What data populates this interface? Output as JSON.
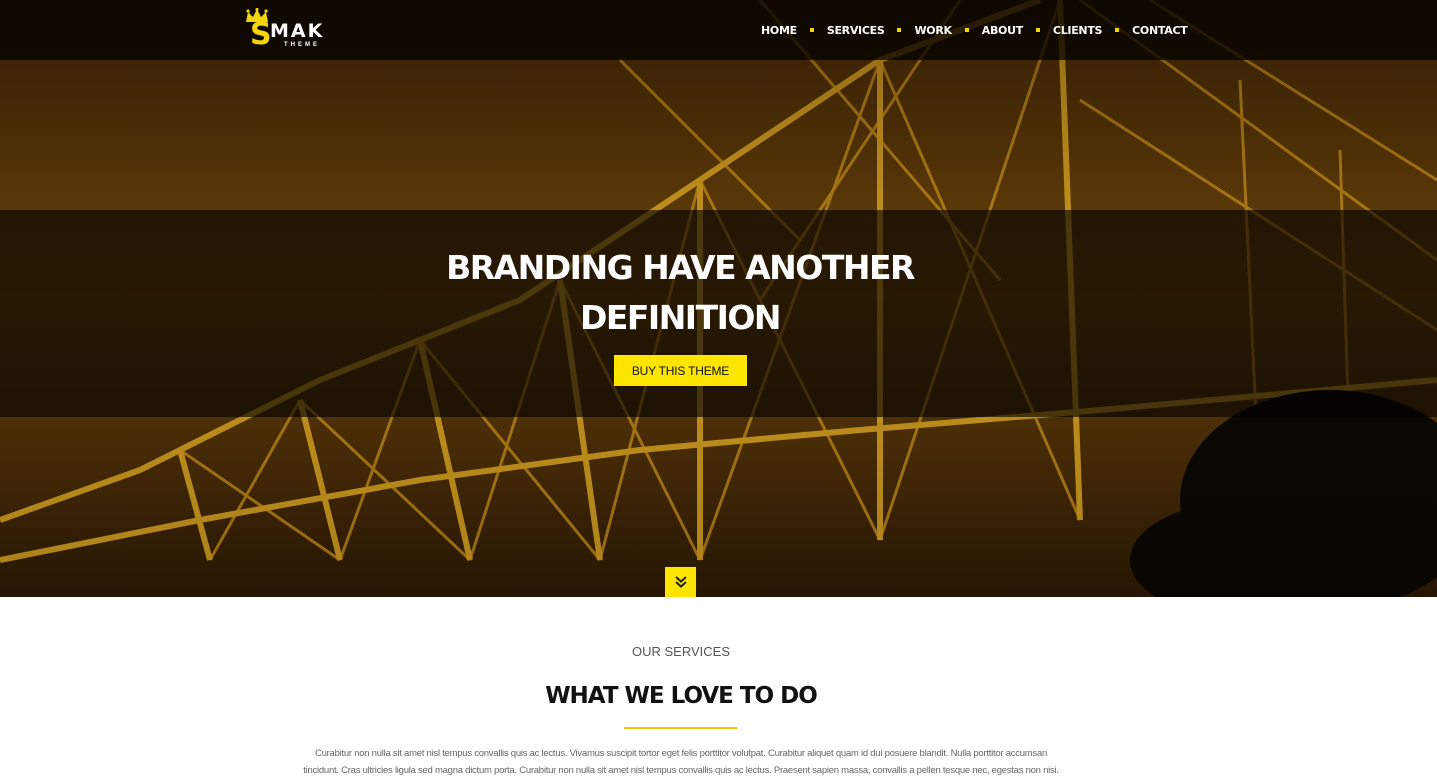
{
  "logo": {
    "letter": "S",
    "name": "MAK",
    "tagline": "THEME"
  },
  "nav": {
    "items": [
      "HOME",
      "SERVICES",
      "WORK",
      "ABOUT",
      "CLIENTS",
      "CONTACT"
    ]
  },
  "hero": {
    "headline_line1": "BRANDING HAVE ANOTHER",
    "headline_line2": "DEFINITION",
    "cta_label": "BUY THIS THEME",
    "scroll_icon": "double-chevron-down-icon"
  },
  "services": {
    "eyebrow": "OUR SERVICES",
    "title": "WHAT WE LOVE TO DO",
    "body": "Curabitur non nulla sit amet nisl tempus convallis quis ac lectus. Vivamus suscipit tortor eget felis porttitor volutpat. Curabitur aliquet quam id dui posuere blandit. Nulla porttitor accumsan tincidunt. Cras ultricies ligula sed magna dictum porta. Curabitur non nulla sit amet nisl tempus convallis quis ac lectus. Praesent sapien massa, convallis a pellen tesque nec, egestas non nisi."
  },
  "colors": {
    "accent": "#fde500",
    "nav_bg": "#000000",
    "text_dark": "#111111"
  }
}
